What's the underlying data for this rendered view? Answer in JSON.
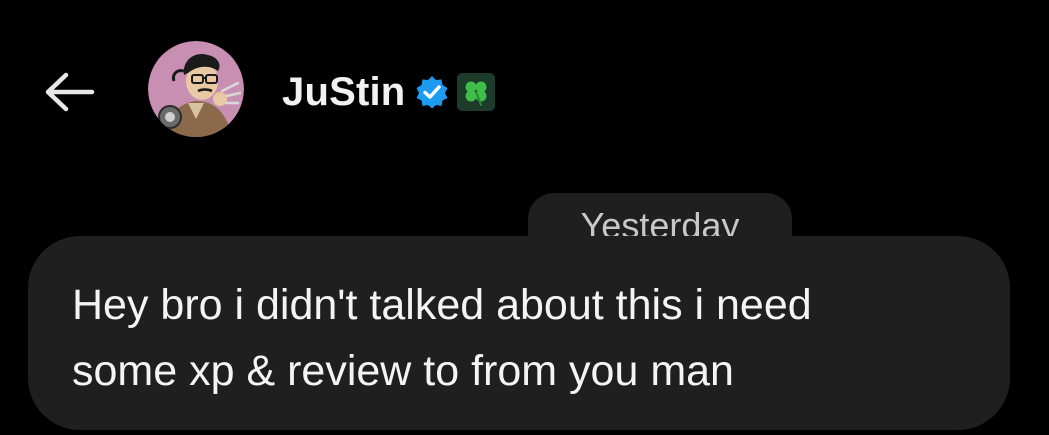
{
  "header": {
    "back_icon": "arrow-left-icon",
    "avatar_icon": "user-avatar",
    "name": "JuStin",
    "verified_icon": "verified-badge-icon",
    "clover_emoji": "🍀"
  },
  "conversation": {
    "date_label": "Yesterday",
    "message": {
      "text": "Hey bro i didn't talked about this i need\nsome xp & review to from you man"
    }
  },
  "colors": {
    "background": "#000000",
    "bubble": "#1f1f1f",
    "verified": "#1d9bf0",
    "text": "#f4f4f4",
    "muted_text": "#c8c8c8"
  }
}
